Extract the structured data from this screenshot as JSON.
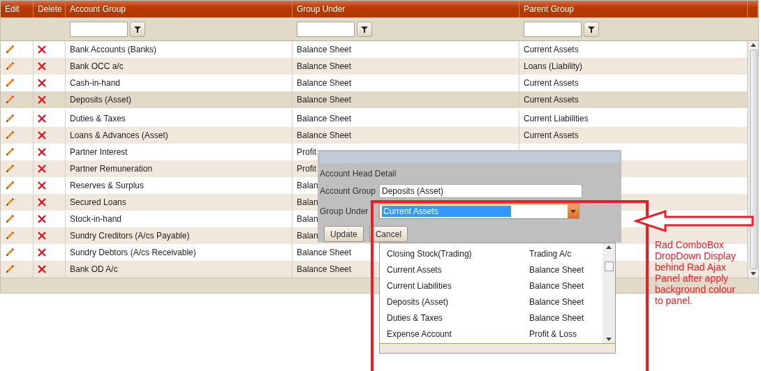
{
  "grid": {
    "columns": [
      "Edit",
      "Delete",
      "Account Group",
      "Group Under",
      "Parent Group"
    ],
    "rows": [
      {
        "account_group": "Bank Accounts (Banks)",
        "group_under": "Balance Sheet",
        "parent_group": "Current Assets",
        "selected": false
      },
      {
        "account_group": "Bank OCC a/c",
        "group_under": "Balance Sheet",
        "parent_group": "Loans (Liability)",
        "selected": false
      },
      {
        "account_group": "Cash-in-hand",
        "group_under": "Balance Sheet",
        "parent_group": "Current Assets",
        "selected": false
      },
      {
        "account_group": "Deposits (Asset)",
        "group_under": "Balance Sheet",
        "parent_group": "Current Assets",
        "selected": true
      },
      {
        "account_group": "Duties & Taxes",
        "group_under": "Balance Sheet",
        "parent_group": "Current Liabilities",
        "selected": false
      },
      {
        "account_group": "Loans & Advances (Asset)",
        "group_under": "Balance Sheet",
        "parent_group": "Current Assets",
        "selected": false
      },
      {
        "account_group": "Partner Interest",
        "group_under": "Profit",
        "selected": false
      },
      {
        "account_group": "Partner Remuneration",
        "group_under": "Profit",
        "selected": false
      },
      {
        "account_group": "Reserves & Surplus",
        "group_under": "Balan",
        "selected": false
      },
      {
        "account_group": "Secured Loans",
        "group_under": "Balan",
        "selected": false
      },
      {
        "account_group": "Stock-in-hand",
        "group_under": "Balan",
        "selected": false
      },
      {
        "account_group": "Sundry Creditors (A/cs Payable)",
        "group_under": "Balan",
        "selected": false
      },
      {
        "account_group": "Sundry Debtors (A/cs Receivable)",
        "group_under": "Balance Sheet",
        "selected": false
      },
      {
        "account_group": "Bank OD A/c",
        "group_under": "Balance Sheet",
        "selected": false
      }
    ]
  },
  "panel": {
    "heading": "Account Head Detail",
    "account_group_label": "Account Group",
    "account_group_value": "Deposits (Asset)",
    "group_under_label": "Group Under",
    "group_under_value": "Current Assets",
    "buttons": [
      "Update",
      "Cancel"
    ]
  },
  "dropdown": {
    "items": [
      {
        "name": "Closing Stock(Trading)",
        "group": "Trading A/c"
      },
      {
        "name": "Current Assets",
        "group": "Balance Sheet"
      },
      {
        "name": "Current Liabilities",
        "group": "Balance Sheet"
      },
      {
        "name": "Deposits (Asset)",
        "group": "Balance Sheet"
      },
      {
        "name": "Duties & Taxes",
        "group": "Balance Sheet"
      },
      {
        "name": "Expense Account",
        "group": "Profit & Loss"
      }
    ]
  },
  "annotation": "Rad ComboBox DropDown Display behind Rad Ajax Panel after apply background colour to panel."
}
